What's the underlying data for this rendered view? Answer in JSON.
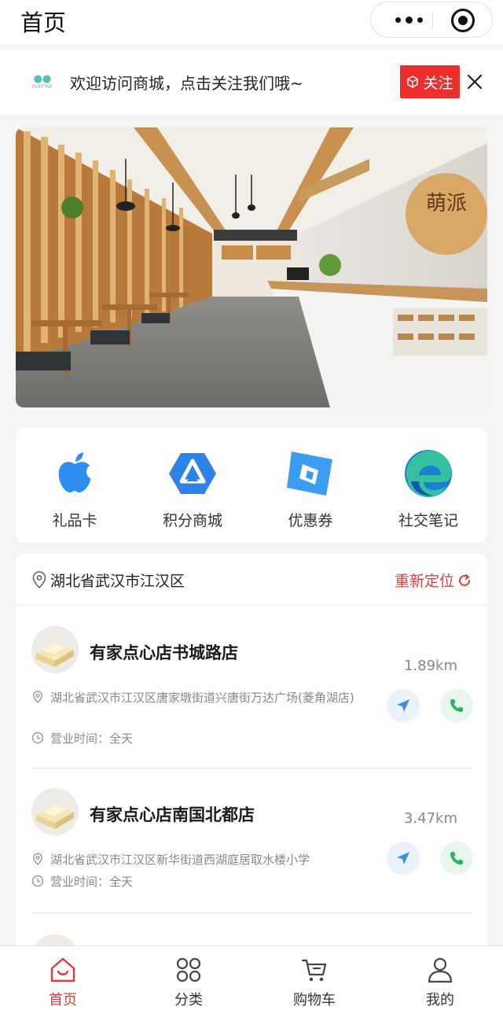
{
  "header": {
    "title": "首页"
  },
  "follow_bar": {
    "logo_text": "PUFFINE",
    "message": "欢迎访问商城，点击关注我们哦~",
    "follow_label": "关注"
  },
  "banner": {
    "sign_text": "萌派"
  },
  "features": [
    {
      "label": "礼品卡",
      "icon": "apple-icon"
    },
    {
      "label": "积分商城",
      "icon": "triangle-logo-icon"
    },
    {
      "label": "优惠券",
      "icon": "square-logo-icon"
    },
    {
      "label": "社交笔记",
      "icon": "edge-browser-icon"
    }
  ],
  "location": {
    "city": "湖北省武汉市江汉区",
    "relocate_label": "重新定位"
  },
  "stores": [
    {
      "name": "有家点心店书城路店",
      "distance": "1.89km",
      "address": "湖北省武汉市江汉区唐家墩街道兴唐街万达广场(菱角湖店)",
      "hours": "营业时间：全天"
    },
    {
      "name": "有家点心店南国北都店",
      "distance": "3.47km",
      "address": "湖北省武汉市江汉区新华街道西湖庭居取水楼小学",
      "hours": "营业时间：全天"
    }
  ],
  "tabbar": [
    {
      "label": "首页",
      "icon": "home-icon",
      "active": true
    },
    {
      "label": "分类",
      "icon": "category-icon",
      "active": false
    },
    {
      "label": "购物车",
      "icon": "cart-icon",
      "active": false
    },
    {
      "label": "我的",
      "icon": "user-icon",
      "active": false
    }
  ],
  "colors": {
    "accent": "#ee2d2d",
    "nav_blue": "#3a8ee6",
    "call_green": "#2bb35e"
  }
}
